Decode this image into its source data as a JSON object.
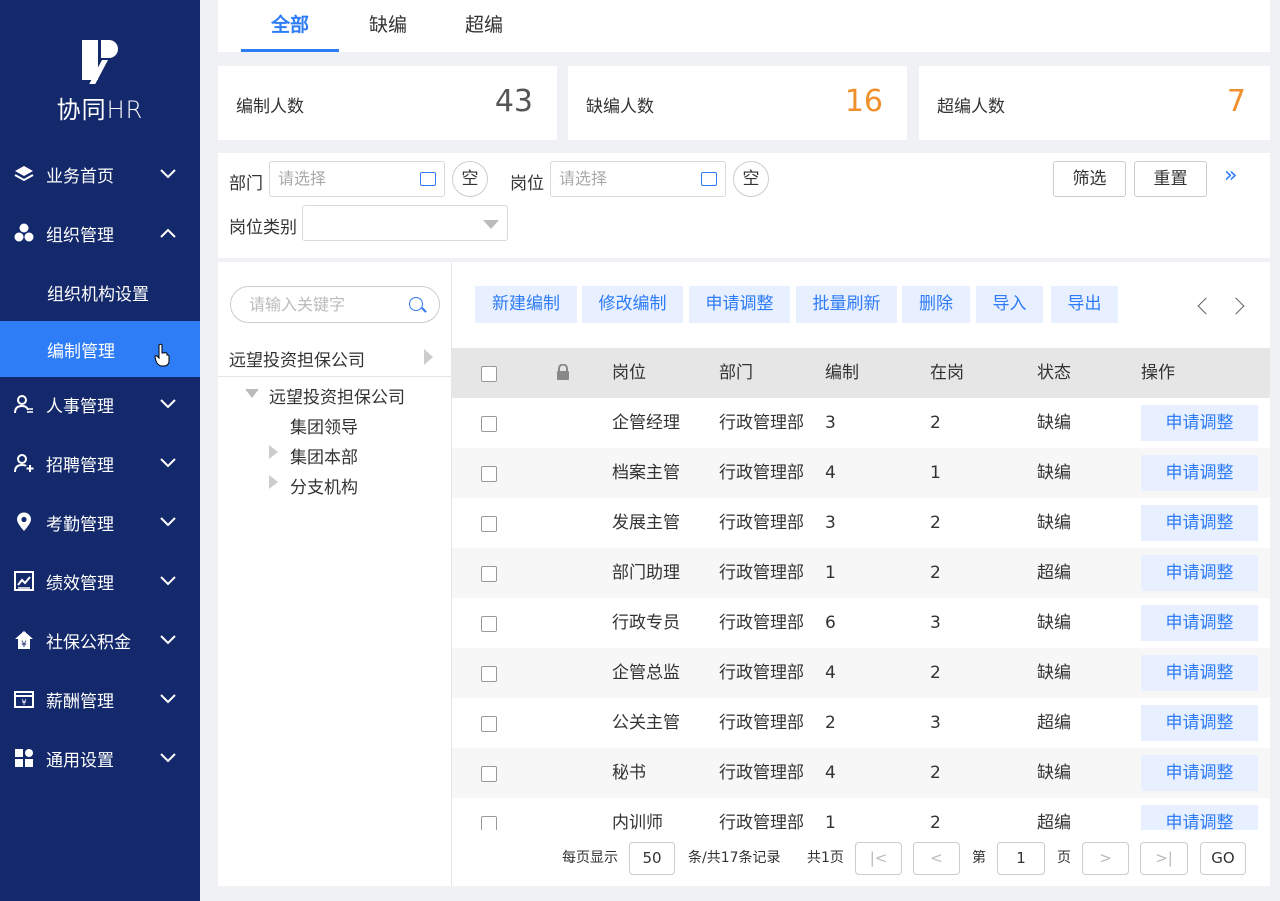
{
  "sidebar": {
    "brand": "协同HR",
    "items": [
      {
        "label": "业务首页",
        "icon": "layers-icon"
      },
      {
        "label": "组织管理",
        "icon": "org-icon"
      },
      {
        "label": "人事管理",
        "icon": "person-icon"
      },
      {
        "label": "招聘管理",
        "icon": "person-add-icon"
      },
      {
        "label": "考勤管理",
        "icon": "location-icon"
      },
      {
        "label": "绩效管理",
        "icon": "chart-icon"
      },
      {
        "label": "社保公积金",
        "icon": "house-icon"
      },
      {
        "label": "薪酬管理",
        "icon": "wallet-icon"
      },
      {
        "label": "通用设置",
        "icon": "grid-icon"
      }
    ],
    "sub_items": [
      {
        "label": "组织机构设置"
      },
      {
        "label": "编制管理"
      }
    ]
  },
  "tabs": [
    {
      "label": "全部"
    },
    {
      "label": "缺编"
    },
    {
      "label": "超编"
    }
  ],
  "stats": [
    {
      "label": "编制人数",
      "value": "43",
      "color": "#555555"
    },
    {
      "label": "缺编人数",
      "value": "16",
      "color": "#f0902a"
    },
    {
      "label": "超编人数",
      "value": "7",
      "color": "#f0902a"
    }
  ],
  "filter": {
    "dept_label": "部门",
    "dept_placeholder": "请选择",
    "pos_label": "岗位",
    "pos_placeholder": "请选择",
    "clear_label": "空",
    "category_label": "岗位类别",
    "category_value": "",
    "filter_btn": "筛选",
    "reset_btn": "重置",
    "expand": "»"
  },
  "tree": {
    "search_placeholder": "请输入关键字",
    "root": "远望投资担保公司",
    "child": "远望投资担保公司",
    "nodes": [
      "集团领导",
      "集团本部",
      "分支机构"
    ]
  },
  "toolbar": {
    "buttons": [
      "新建编制",
      "修改编制",
      "申请调整",
      "批量刷新",
      "删除",
      "导入",
      "导出"
    ]
  },
  "table": {
    "columns": [
      "岗位",
      "部门",
      "编制",
      "在岗",
      "状态",
      "操作"
    ],
    "action_label": "申请调整",
    "rows": [
      {
        "pos": "企管经理",
        "dept": "行政管理部",
        "quota": "3",
        "onjob": "2",
        "status": "缺编"
      },
      {
        "pos": "档案主管",
        "dept": "行政管理部",
        "quota": "4",
        "onjob": "1",
        "status": "缺编"
      },
      {
        "pos": "发展主管",
        "dept": "行政管理部",
        "quota": "3",
        "onjob": "2",
        "status": "缺编"
      },
      {
        "pos": "部门助理",
        "dept": "行政管理部",
        "quota": "1",
        "onjob": "2",
        "status": "超编"
      },
      {
        "pos": "行政专员",
        "dept": "行政管理部",
        "quota": "6",
        "onjob": "3",
        "status": "缺编"
      },
      {
        "pos": "企管总监",
        "dept": "行政管理部",
        "quota": "4",
        "onjob": "2",
        "status": "缺编"
      },
      {
        "pos": "公关主管",
        "dept": "行政管理部",
        "quota": "2",
        "onjob": "3",
        "status": "超编"
      },
      {
        "pos": "秘书",
        "dept": "行政管理部",
        "quota": "4",
        "onjob": "2",
        "status": "缺编"
      },
      {
        "pos": "内训师",
        "dept": "行政管理部",
        "quota": "1",
        "onjob": "2",
        "status": "超编"
      }
    ]
  },
  "pager": {
    "per_page_label": "每页显示",
    "per_page": "50",
    "records": "条/共17条记录",
    "pages": "共1页",
    "page_prefix": "第",
    "page": "1",
    "page_suffix": "页",
    "go": "GO"
  }
}
